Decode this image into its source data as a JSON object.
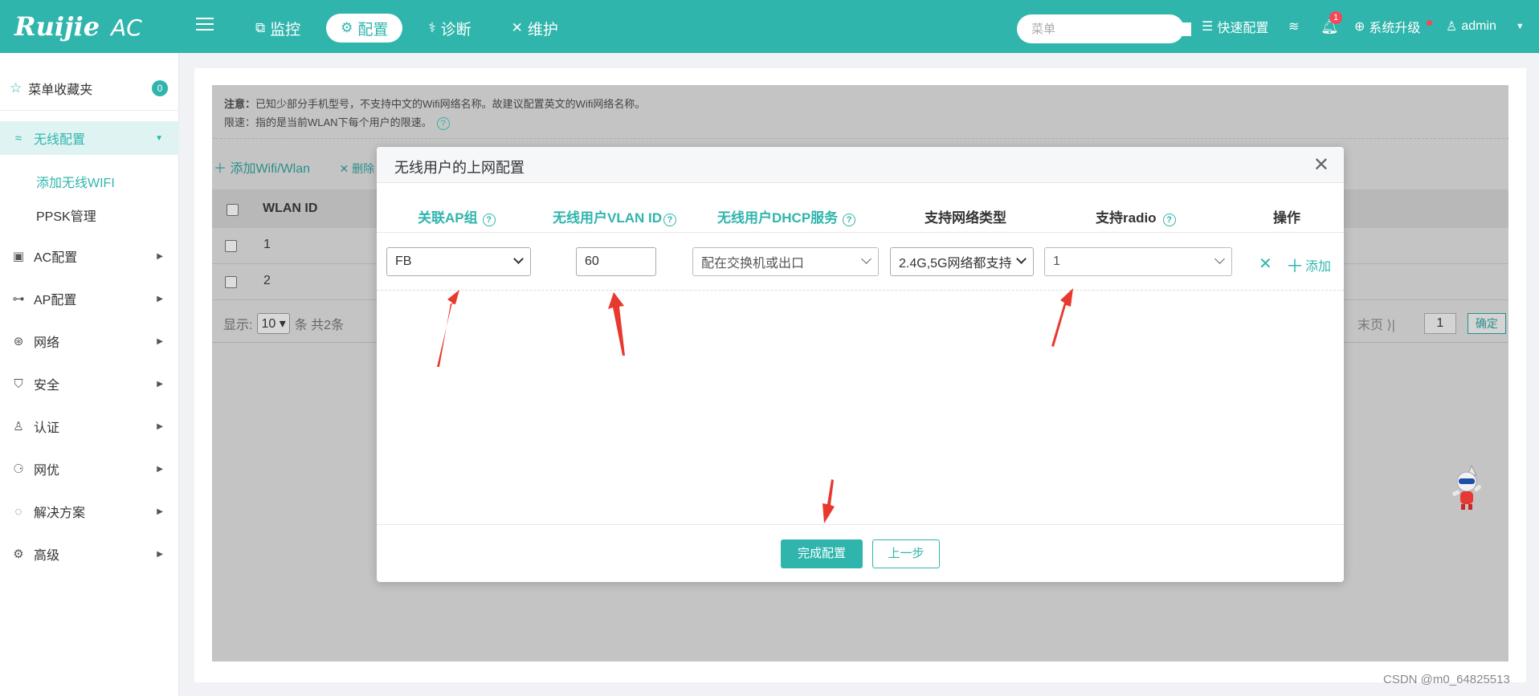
{
  "brand": {
    "logo_text": "Ruijie",
    "product": "AC"
  },
  "topnav": {
    "items": [
      {
        "icon": "monitor-icon",
        "label": "监控",
        "active": false
      },
      {
        "icon": "gear-icon",
        "label": "配置",
        "active": true
      },
      {
        "icon": "stethoscope-icon",
        "label": "诊断",
        "active": false
      },
      {
        "icon": "wrench-icon",
        "label": "维护",
        "active": false
      }
    ],
    "search_placeholder": "菜单",
    "quick_config": "快速配置",
    "notification_count": "1",
    "upgrade": "系统升级",
    "user": "admin"
  },
  "sidebar": {
    "favorites": {
      "label": "菜单收藏夹",
      "count": "0"
    },
    "items": [
      {
        "label": "无线配置",
        "icon": "wifi-icon",
        "active": true,
        "expanded": true
      },
      {
        "label": "AC配置",
        "icon": "ac-icon"
      },
      {
        "label": "AP配置",
        "icon": "ap-icon"
      },
      {
        "label": "网络",
        "icon": "network-icon"
      },
      {
        "label": "安全",
        "icon": "shield-icon"
      },
      {
        "label": "认证",
        "icon": "user-icon"
      },
      {
        "label": "网优",
        "icon": "optimize-icon"
      },
      {
        "label": "解决方案",
        "icon": "bulb-icon"
      },
      {
        "label": "高级",
        "icon": "settings-icon"
      }
    ],
    "subitems": [
      {
        "label": "添加无线WIFI",
        "active": true
      },
      {
        "label": "PPSK管理",
        "active": false
      }
    ]
  },
  "background": {
    "notice_label": "注意：",
    "notice_text": "已知少部分手机型号，不支持中文的Wifi网络名称。故建议配置英文的Wifi网络名称。",
    "limit_label": "限速：",
    "limit_text": "指的是当前WLAN下每个用户的限速。",
    "add_button": "添加Wifi/Wlan",
    "delete_button": "删除",
    "column_wlan_id": "WLAN ID",
    "rows": [
      "1",
      "2"
    ],
    "pager": {
      "show_label": "显示:",
      "page_size": "10",
      "total": "条 共2条",
      "last_page": "末页",
      "page_input": "1",
      "confirm": "确定"
    }
  },
  "modal": {
    "title": "无线用户的上网配置",
    "columns": [
      {
        "label": "关联AP组",
        "help": "?"
      },
      {
        "label": "无线用户VLAN ID",
        "help": "?"
      },
      {
        "label": "无线用户DHCP服务",
        "help": "?"
      },
      {
        "label": "支持网络类型"
      },
      {
        "label": "支持radio",
        "help": "?"
      },
      {
        "label": "操作"
      }
    ],
    "row": {
      "ap_group": "FB",
      "vlan_id": "60",
      "dhcp": "配在交换机或出口",
      "network_type": "2.4G,5G网络都支持",
      "radio": "1",
      "add_label": "添加"
    },
    "finish_button": "完成配置",
    "prev_button": "上一步"
  },
  "watermark": "CSDN @m0_64825513",
  "colors": {
    "primary": "#2fb5ac",
    "annotation_arrow": "#e8392e",
    "badge": "#f5475a"
  }
}
